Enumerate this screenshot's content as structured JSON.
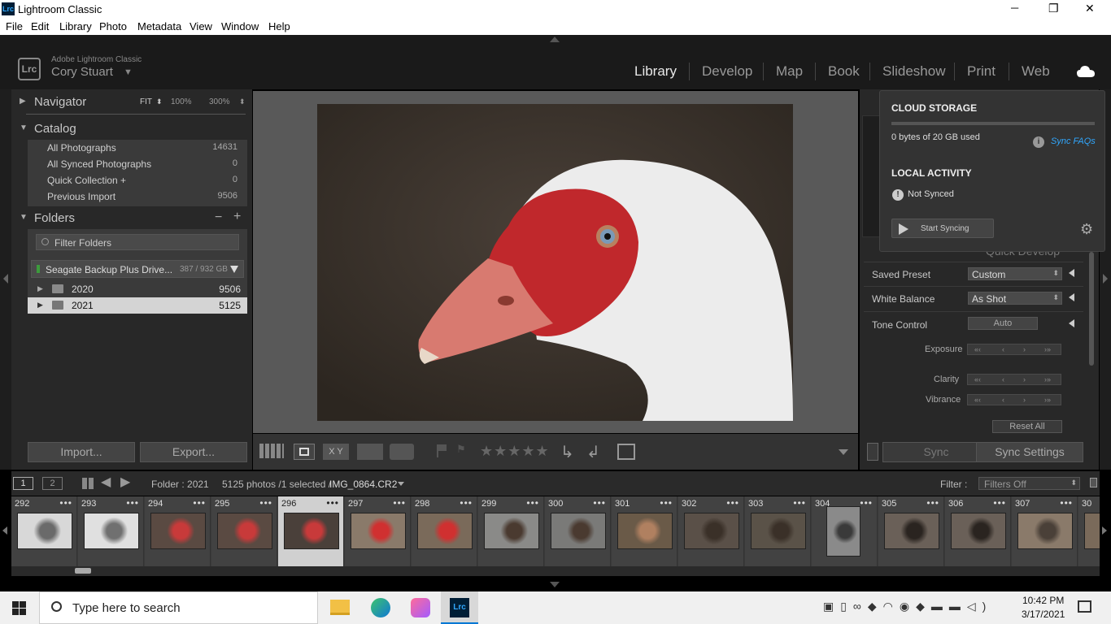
{
  "window": {
    "app_icon": "Lrc",
    "title": "Lightroom Classic",
    "controls": {
      "minimize": "─",
      "restore": "❐",
      "close": "✕"
    }
  },
  "menu": [
    "File",
    "Edit",
    "Library",
    "Photo",
    "Metadata",
    "View",
    "Window",
    "Help"
  ],
  "identity": {
    "logo": "Lrc",
    "product": "Adobe Lightroom Classic",
    "user": "Cory Stuart",
    "user_arrow": "▼"
  },
  "modules": [
    "Library",
    "Develop",
    "Map",
    "Book",
    "Slideshow",
    "Print",
    "Web"
  ],
  "active_module": "Library",
  "navigator": {
    "title": "Navigator",
    "zoom_options": [
      "FIT",
      "100%",
      "300%"
    ],
    "zoom_arrow": "⬍",
    "fit_arrow": "⬍"
  },
  "catalog": {
    "title": "Catalog",
    "rows": [
      {
        "label": "All Photographs",
        "count": "14631"
      },
      {
        "label": "All Synced Photographs",
        "count": "0"
      },
      {
        "label": "Quick Collection  +",
        "count": "0"
      },
      {
        "label": "Previous Import",
        "count": "9506"
      }
    ]
  },
  "folders": {
    "title": "Folders",
    "minus": "−",
    "plus": "+",
    "filter_placeholder": "Filter Folders",
    "volume": {
      "name": "Seagate Backup Plus Drive...",
      "usage": "387 / 932 GB"
    },
    "items": [
      {
        "name": "2020",
        "count": "9506"
      },
      {
        "name": "2021",
        "count": "5125"
      }
    ]
  },
  "left_buttons": {
    "import": "Import...",
    "export": "Export..."
  },
  "quick_develop": {
    "title": "Quick Develop",
    "saved_preset": {
      "label": "Saved Preset",
      "value": "Custom"
    },
    "white_balance": {
      "label": "White Balance",
      "value": "As Shot"
    },
    "tone_control": {
      "label": "Tone Control",
      "value": "Auto"
    },
    "sliders": [
      "Exposure",
      "Clarity",
      "Vibrance"
    ],
    "reset": "Reset All"
  },
  "right_buttons": {
    "sync": "Sync",
    "sync_settings": "Sync Settings"
  },
  "cloud_popup": {
    "storage_title": "CLOUD STORAGE",
    "storage_used": "0 bytes of 20 GB used",
    "faq": "Sync FAQs",
    "activity_title": "LOCAL ACTIVITY",
    "status": "Not Synced",
    "start_button": "Start Syncing",
    "storage_fraction": 0
  },
  "filmstrip_header": {
    "view1": "1",
    "view2": "2",
    "folder": "Folder : 2021",
    "count": "5125 photos /1 selected /",
    "filename": "IMG_0864.CR2",
    "filter_label": "Filter :",
    "filter_value": "Filters Off"
  },
  "filmstrip": [
    {
      "num": "292",
      "tone": "#d8d8d8",
      "accent": "#6a6a6a"
    },
    {
      "num": "293",
      "tone": "#e0e0e0",
      "accent": "#707070"
    },
    {
      "num": "294",
      "tone": "#5a4a42",
      "accent": "#c83a3a"
    },
    {
      "num": "295",
      "tone": "#5a4a42",
      "accent": "#c83a3a"
    },
    {
      "num": "296",
      "tone": "#4a403a",
      "accent": "#c83a3a"
    },
    {
      "num": "297",
      "tone": "#8a7a6a",
      "accent": "#d03030"
    },
    {
      "num": "298",
      "tone": "#7a6a5a",
      "accent": "#d03030"
    },
    {
      "num": "299",
      "tone": "#8a8a88",
      "accent": "#4a3a30"
    },
    {
      "num": "300",
      "tone": "#7a7a78",
      "accent": "#4a3a30"
    },
    {
      "num": "301",
      "tone": "#6a5a48",
      "accent": "#b08060"
    },
    {
      "num": "302",
      "tone": "#5a5048",
      "accent": "#3a3028"
    },
    {
      "num": "303",
      "tone": "#5a5248",
      "accent": "#3a3028"
    },
    {
      "num": "304",
      "tone": "#8a8a8a",
      "accent": "#3a3a3a"
    },
    {
      "num": "305",
      "tone": "#6a6058",
      "accent": "#2a2420"
    },
    {
      "num": "306",
      "tone": "#6a6058",
      "accent": "#2a2420"
    },
    {
      "num": "307",
      "tone": "#8a7a6a",
      "accent": "#4a4038"
    },
    {
      "num": "30",
      "tone": "#7a6a5a",
      "accent": "#4a4038"
    }
  ],
  "taskbar": {
    "search_placeholder": "Type here to search",
    "time": "10:42 PM",
    "date": "3/17/2021"
  }
}
